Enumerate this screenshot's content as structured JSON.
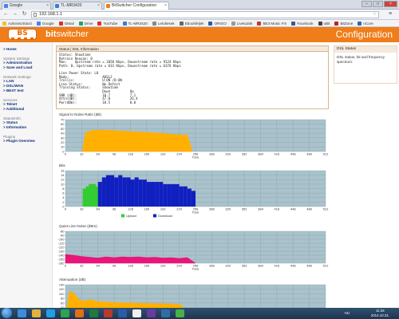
{
  "browser": {
    "tabs": [
      {
        "label": "Google",
        "color": "#4285f4"
      },
      {
        "label": "TL-MR3420",
        "color": "#3a7bd5"
      },
      {
        "label": "BitSwitcher Configuration",
        "color": "#ef7d1a"
      }
    ],
    "url": "192.168.1.1",
    "bookmarks": [
      {
        "label": "Adminisztráció",
        "color": "#f2c12e"
      },
      {
        "label": "Google",
        "color": "#4285f4"
      },
      {
        "label": "GMail",
        "color": "#d93025"
      },
      {
        "label": "Drive",
        "color": "#1fa463"
      },
      {
        "label": "YouTube",
        "color": "#e52d27"
      },
      {
        "label": "TL-MR3420",
        "color": "#3a7bd5"
      },
      {
        "label": "Letoltesek",
        "color": "#888888"
      },
      {
        "label": "Ebookfeljek",
        "color": "#666666"
      },
      {
        "label": "ORIGO",
        "color": "#2b5aa3"
      },
      {
        "label": "Livetudok",
        "color": "#999999"
      },
      {
        "label": "BE3 Music Fm",
        "color": "#cc3333"
      },
      {
        "label": "Facebook",
        "color": "#3b5998"
      },
      {
        "label": "uBit",
        "color": "#444444"
      },
      {
        "label": "BitZone",
        "color": "#bb2222"
      },
      {
        "label": "nCore",
        "color": "#3366aa"
      }
    ]
  },
  "header": {
    "logo_text": "BS",
    "brand_bit": "bit",
    "brand_switcher": "switcher",
    "config_title": "Configuration"
  },
  "sidebar": {
    "home": "> Home",
    "sections": [
      {
        "title": "System Settings",
        "links": [
          "> Administration",
          "> Save and Load"
        ]
      },
      {
        "title": "Network Settings",
        "links": [
          "> LAN",
          "> DSL/WAN",
          "> BEXT test"
        ]
      },
      {
        "title": "Services",
        "links": [
          "> Telnet",
          "> Additional"
        ]
      },
      {
        "title": "Status/Info",
        "links": [
          "> Status",
          "> Information"
        ]
      },
      {
        "title": "Plugins",
        "links": [
          "> Plugin Overview"
        ]
      }
    ]
  },
  "dsl_panel": {
    "title": "Status | DSL Information",
    "lines": [
      "Status: Showtime",
      "Retrain Reason: 0",
      "Max:    Upstream rate = 1058 Kbps, Downstream rate = 9124 Kbps",
      "Path: 0, Upstream rate = 633 Kbps, Downstream rate = 6376 Kbps",
      "",
      "Line Power State: L0",
      "Mode:                 ADSL2",
      "Trellis:              U:ON /D:ON",
      "Line Status:          No Defect",
      "Training Status:      Showtime",
      "                      Down          Up",
      "SNR (dB):             10.7          7.1",
      "Attn(dB):             47.8          26.4",
      "Pwr(dBm):             18.5          0.0"
    ]
  },
  "info_panel": {
    "title": "DSL Status",
    "text": "DSL status, bit and frequency spectrum."
  },
  "colors": {
    "orange": "#ef7d1a",
    "chart_bg": "#a9c2cc",
    "snr_fill": "#ffb000",
    "upload": "#33cc33",
    "download": "#1020c0",
    "qln": "#e8157a"
  },
  "chart_data": [
    {
      "type": "area",
      "title": "Signal to Noise Ratio (dB)",
      "xlabel": "Tone",
      "ylabel": "",
      "ylim": [
        0,
        70
      ],
      "yticks": [
        0,
        10,
        20,
        30,
        40,
        50,
        60,
        70
      ],
      "xticks": [
        0,
        32,
        64,
        96,
        128,
        160,
        192,
        224,
        256,
        288,
        320,
        352,
        384,
        416,
        448,
        480,
        512
      ],
      "x": [
        33,
        40,
        48,
        56,
        64,
        80,
        96,
        112,
        128,
        144,
        160,
        176,
        192,
        208,
        224,
        240,
        250
      ],
      "values": [
        0,
        42,
        45,
        47,
        47,
        47,
        46,
        45,
        44,
        43,
        42,
        41,
        40,
        38,
        37,
        36,
        0
      ],
      "color": "#ffb000"
    },
    {
      "type": "bar",
      "title": "Bits",
      "xlabel": "Tone",
      "ylabel": "",
      "ylim": [
        0,
        16
      ],
      "yticks": [
        0,
        2,
        4,
        6,
        8,
        10,
        12,
        14,
        16
      ],
      "xticks": [
        0,
        32,
        64,
        96,
        128,
        160,
        192,
        224,
        256,
        288,
        320,
        352,
        384,
        416,
        448,
        480,
        512
      ],
      "legend": [
        "Upload",
        "Download"
      ],
      "series": [
        {
          "name": "Upload",
          "color": "#33cc33",
          "x": [
            34,
            40,
            46,
            52,
            58
          ],
          "values": [
            8,
            9,
            10,
            10,
            9
          ]
        },
        {
          "name": "Download",
          "color": "#1020c0",
          "x": [
            64,
            72,
            80,
            88,
            96,
            104,
            112,
            120,
            128,
            136,
            144,
            152,
            160,
            168,
            176,
            184,
            192,
            200,
            208,
            216,
            224,
            232,
            240,
            248
          ],
          "values": [
            11,
            13,
            14,
            14,
            13,
            14,
            13,
            13,
            12,
            13,
            12,
            12,
            11,
            11,
            11,
            11,
            10,
            10,
            10,
            10,
            9,
            9,
            8,
            7
          ]
        }
      ]
    },
    {
      "type": "area",
      "title": "Quiet Line Noise (dBm)",
      "xlabel": "Tone",
      "ylabel": "",
      "ylim": [
        -160,
        -80
      ],
      "yticks": [
        -80,
        -90,
        -100,
        -110,
        -120,
        -130,
        -140,
        -150,
        -160
      ],
      "xticks": [
        0,
        32,
        64,
        96,
        128,
        160,
        192,
        224,
        256,
        288,
        320,
        352,
        384,
        416,
        448,
        480,
        512
      ],
      "x": [
        0,
        16,
        32,
        48,
        64,
        80,
        96,
        112,
        128,
        144,
        160,
        176,
        192,
        208,
        224,
        240,
        256
      ],
      "values": [
        -138,
        -140,
        -143,
        -145,
        -147,
        -144,
        -146,
        -144,
        -145,
        -144,
        -146,
        -145,
        -147,
        -146,
        -148,
        -146,
        -160
      ],
      "color": "#e8157a"
    },
    {
      "type": "area",
      "title": "Attenuation (dB)",
      "xlabel": "Tone",
      "ylabel": "",
      "ylim": [
        0,
        140
      ],
      "yticks": [
        0,
        20,
        40,
        60,
        80,
        100,
        120,
        140
      ],
      "xticks": [
        0,
        32,
        64,
        96,
        128,
        160,
        192,
        224,
        256,
        288,
        320,
        352,
        384,
        416,
        448,
        480,
        512
      ],
      "x": [
        0,
        8,
        16,
        24,
        32,
        40,
        48,
        64,
        96,
        128,
        160,
        192,
        224,
        256
      ],
      "values": [
        0,
        110,
        105,
        80,
        70,
        68,
        75,
        66,
        62,
        60,
        58,
        57,
        55,
        0
      ],
      "color": "#ffb000"
    }
  ],
  "chart_legend": {
    "upload": "Upload",
    "download": "Download"
  },
  "taskbar": {
    "lang": "HU",
    "time": "11:34",
    "date": "2014.10.31."
  }
}
